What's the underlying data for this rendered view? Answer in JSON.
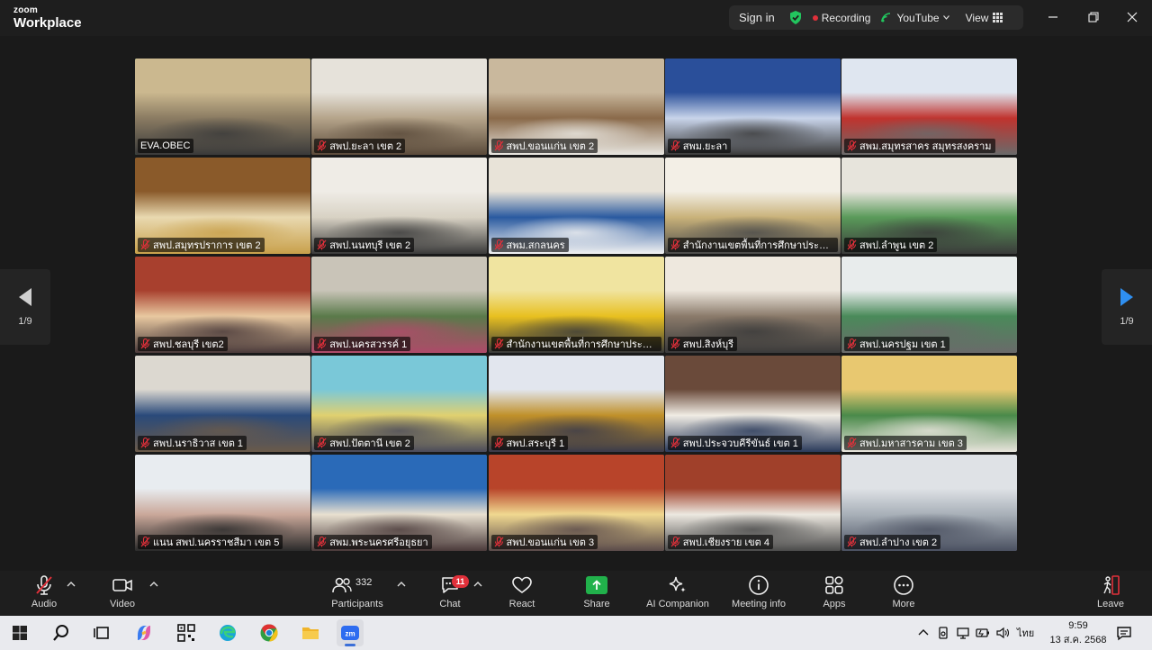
{
  "window": {
    "brand_top": "zoom",
    "brand_bottom": "Workplace",
    "sign_in": "Sign in",
    "recording": "Recording",
    "youtube": "YouTube",
    "view": "View"
  },
  "stage": {
    "page_left": "1/9",
    "page_right": "1/9",
    "tiles": [
      {
        "name": "EVA.OBEC",
        "scene": [
          "#cbb88f",
          "#8a7b62",
          "#3a3a3a"
        ],
        "muted": false,
        "active": true
      },
      {
        "name": "สพป.ยะลา เขต 2",
        "scene": [
          "#e6e2da",
          "#b5a48a",
          "#5a4a3a"
        ],
        "muted": true,
        "active": false
      },
      {
        "name": "สพป.ขอนแก่น เขต 2",
        "scene": [
          "#c9b89d",
          "#8a6a4a",
          "#e8e6e0"
        ],
        "muted": true,
        "active": false
      },
      {
        "name": "สพม.ยะลา",
        "scene": [
          "#2a4f9a",
          "#c8d4ea",
          "#3a3a3a"
        ],
        "muted": true,
        "active": false
      },
      {
        "name": "สพม.สมุทรสาคร สมุทรสงคราม",
        "scene": [
          "#dfe6f0",
          "#c0332e",
          "#6a6a6a"
        ],
        "muted": true,
        "active": false
      },
      {
        "name": "สพป.สมุทรปราการ เขต 2",
        "scene": [
          "#8a5a2a",
          "#e9d9b0",
          "#c8a04a"
        ],
        "muted": true,
        "active": false
      },
      {
        "name": "สพป.นนทบุรี เขต 2",
        "scene": [
          "#efece6",
          "#d8d2c4",
          "#3a3a3a"
        ],
        "muted": true,
        "active": false
      },
      {
        "name": "สพม.สกลนคร",
        "scene": [
          "#e8e3d8",
          "#2a5aa0",
          "#f2f2f2"
        ],
        "muted": true,
        "active": false
      },
      {
        "name": "สำนักงานเขตพื้นที่การศึกษาประถม...",
        "scene": [
          "#f3efe6",
          "#c9b27a",
          "#4a4a4a"
        ],
        "muted": true,
        "active": false
      },
      {
        "name": "สพป.ลำพูน เขต 2",
        "scene": [
          "#e7e4dc",
          "#5a9a5a",
          "#3a3a3a"
        ],
        "muted": true,
        "active": false
      },
      {
        "name": "สพป.ชลบุรี เขต2",
        "scene": [
          "#a8402e",
          "#e8c8a0",
          "#4a3a3a"
        ],
        "muted": true,
        "active": false
      },
      {
        "name": "สพป.นครสวรรค์ 1",
        "scene": [
          "#c9c4b8",
          "#5a7a4a",
          "#b04a6a"
        ],
        "muted": true,
        "active": false
      },
      {
        "name": "สำนักงานเขตพื้นที่การศึกษาประถม...",
        "scene": [
          "#f0e4a0",
          "#e8c020",
          "#3a3a3a"
        ],
        "muted": true,
        "active": false
      },
      {
        "name": "สพป.สิงห์บุรี",
        "scene": [
          "#eee8de",
          "#8a7a6a",
          "#3a3a3a"
        ],
        "muted": true,
        "active": false
      },
      {
        "name": "สพป.นครปฐม เขต 1",
        "scene": [
          "#e8ecec",
          "#4a8a5a",
          "#6a6a6a"
        ],
        "muted": true,
        "active": false
      },
      {
        "name": "สพป.นราธิวาส เขต 1",
        "scene": [
          "#dcd8d0",
          "#2a4a7a",
          "#6a5a4a"
        ],
        "muted": true,
        "active": false
      },
      {
        "name": "สพป.ปัตตานี เขต 2",
        "scene": [
          "#7ac8d8",
          "#e0d070",
          "#4a4a5a"
        ],
        "muted": true,
        "active": false
      },
      {
        "name": "สพป.สระบุรี 1",
        "scene": [
          "#e2e6ee",
          "#c0902a",
          "#3a3a4a"
        ],
        "muted": true,
        "active": false
      },
      {
        "name": "สพป.ประจวบคีรีขันธ์ เขต 1",
        "scene": [
          "#6a4a3a",
          "#f0ece4",
          "#2a3a5a"
        ],
        "muted": true,
        "active": false
      },
      {
        "name": "สพป.มหาสารคาม เขต 3",
        "scene": [
          "#e8c870",
          "#4a8a4a",
          "#e8e4dc"
        ],
        "muted": true,
        "active": false
      },
      {
        "name": "แนน สพป.นครราชสีมา เขต 5",
        "scene": [
          "#e8ecf0",
          "#caa89a",
          "#2a2a2a"
        ],
        "muted": true,
        "active": false
      },
      {
        "name": "สพม.พระนครศรีอยุธยา",
        "scene": [
          "#2a6ab8",
          "#e8e0d0",
          "#4a3a3a"
        ],
        "muted": true,
        "active": false
      },
      {
        "name": "สพป.ขอนแก่น เขต 3",
        "scene": [
          "#b8442a",
          "#f0d890",
          "#5a4a4a"
        ],
        "muted": true,
        "active": false
      },
      {
        "name": "สพป.เชียงราย เขต 4",
        "scene": [
          "#a0402a",
          "#ece8e0",
          "#4a4a4a"
        ],
        "muted": true,
        "active": false
      },
      {
        "name": "สพป.ลำปาง เขต 2",
        "scene": [
          "#dfe2e6",
          "#a8b0b8",
          "#4a5060"
        ],
        "muted": true,
        "active": false
      }
    ]
  },
  "toolbar": {
    "audio": "Audio",
    "video": "Video",
    "participants": "Participants",
    "participant_count": "332",
    "chat": "Chat",
    "chat_badge": "11",
    "react": "React",
    "share": "Share",
    "ai_companion": "AI Companion",
    "meeting_info": "Meeting info",
    "apps": "Apps",
    "more": "More",
    "leave": "Leave"
  },
  "taskbar": {
    "language": "ไทย",
    "time": "9:59",
    "date": "13 ส.ค. 2568"
  },
  "colors": {
    "accent_green": "#2ecc71",
    "recording_red": "#e0303a",
    "share_green": "#21b14b"
  }
}
